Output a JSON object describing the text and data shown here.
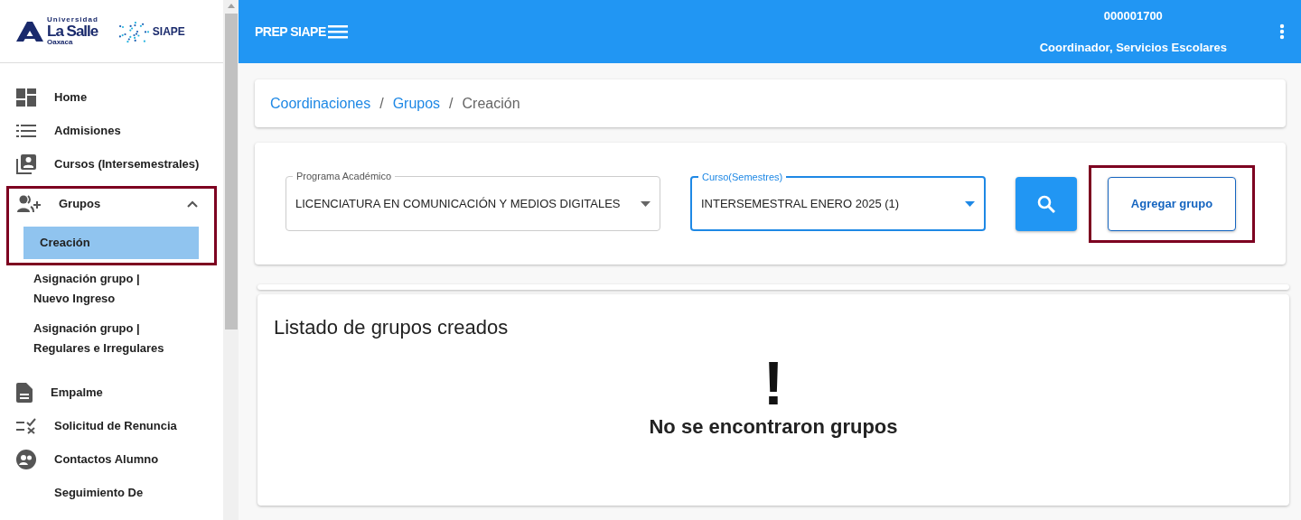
{
  "sidebar": {
    "logo": {
      "line1": "Universidad",
      "line2": "La Salle",
      "line3": "Oaxaca",
      "siape": "SIAPE"
    },
    "items": [
      {
        "label": "Home",
        "kind": "item"
      },
      {
        "label": "Admisiones",
        "kind": "item"
      },
      {
        "label": "Cursos (Intersemestrales)",
        "kind": "item"
      },
      {
        "label": "Grupos",
        "kind": "group",
        "expanded": true,
        "highlighted": true,
        "children": [
          {
            "label": "Creación",
            "selected": true
          },
          {
            "label": "Asignación grupo |",
            "label2": "Nuevo Ingreso",
            "selected": false
          },
          {
            "label": "Asignación grupo |",
            "label2": "Regulares e Irregulares",
            "selected": false
          }
        ]
      },
      {
        "label": "Empalme",
        "kind": "item"
      },
      {
        "label": "Solicitud de Renuncia",
        "kind": "item"
      },
      {
        "label": "Contactos Alumno",
        "kind": "item"
      },
      {
        "label": "Seguimiento De",
        "kind": "text"
      }
    ]
  },
  "topbar": {
    "brand": "PREP SIAPE",
    "user_id": "000001700",
    "role": "Coordinador, Servicios Escolares"
  },
  "breadcrumb_separator": "/",
  "breadcrumb": [
    {
      "label": "Coordinaciones",
      "link": true
    },
    {
      "label": "Grupos",
      "link": true
    },
    {
      "label": "Creación",
      "link": false
    }
  ],
  "filters": [
    {
      "label": "Programa Académico",
      "value": "LICENCIATURA EN COMUNICACIÓN Y MEDIOS DIGITALES",
      "focused": false
    },
    {
      "label": "Curso(Semestres)",
      "value": "INTERSEMESTRAL ENERO 2025 (1)",
      "focused": true
    }
  ],
  "add_button": {
    "label": "Agregar grupo",
    "highlighted": true
  },
  "list": {
    "title": "Listado de grupos creados",
    "empty_icon": "!",
    "empty_message": "No se encontraron grupos"
  }
}
